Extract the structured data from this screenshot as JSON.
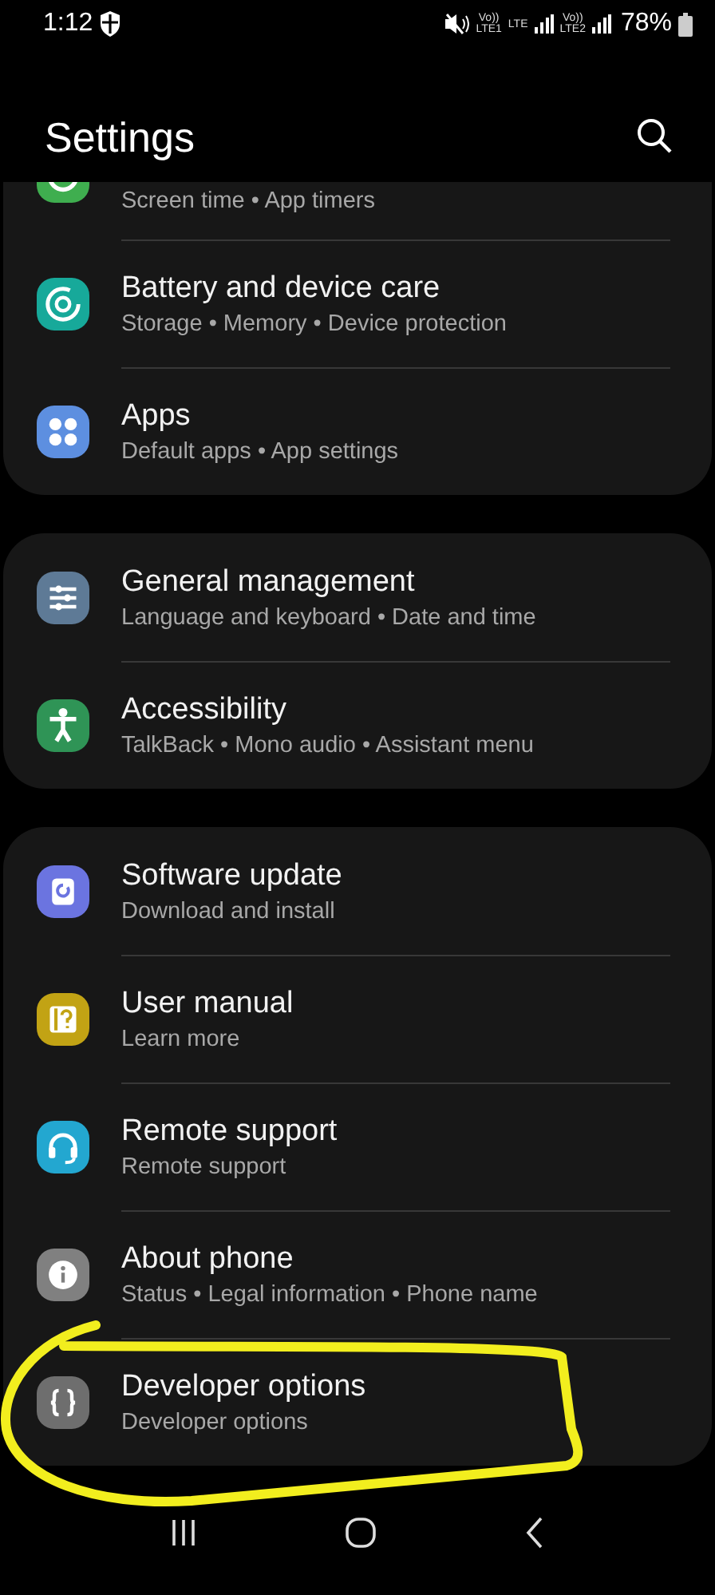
{
  "status_bar": {
    "time": "1:12",
    "network_1": [
      "Vo))",
      "LTE1"
    ],
    "network_type": "LTE",
    "network_2": [
      "Vo))",
      "LTE2"
    ],
    "battery": "78%"
  },
  "header": {
    "title": "Settings"
  },
  "groups": [
    {
      "items": [
        {
          "color": "#3fae4f",
          "subtitle": "Screen time • App timers",
          "circled": false
        },
        {
          "color": "#17a99a",
          "title": "Battery and device care",
          "subtitle": "Storage • Memory • Device protection",
          "circled": false
        },
        {
          "color": "#5d8fe0",
          "title": "Apps",
          "subtitle": "Default apps • App settings",
          "circled": false
        }
      ]
    },
    {
      "items": [
        {
          "color": "#5e7a96",
          "title": "General management",
          "subtitle": "Language and keyboard • Date and time",
          "circled": false
        },
        {
          "color": "#2f9456",
          "title": "Accessibility",
          "subtitle": "TalkBack • Mono audio • Assistant menu",
          "circled": false
        }
      ]
    },
    {
      "items": [
        {
          "color": "#6b74e0",
          "title": "Software update",
          "subtitle": "Download and install",
          "circled": false
        },
        {
          "color": "#c2a314",
          "title": "User manual",
          "subtitle": "Learn more",
          "circled": false
        },
        {
          "color": "#23a7d0",
          "title": "Remote support",
          "subtitle": "Remote support",
          "circled": false
        },
        {
          "color": "#808080",
          "title": "About phone",
          "subtitle": "Status • Legal information • Phone name",
          "circled": false
        },
        {
          "color": "#6e6e6e",
          "title": "Developer options",
          "subtitle": "Developer options",
          "circled": true
        }
      ]
    }
  ]
}
